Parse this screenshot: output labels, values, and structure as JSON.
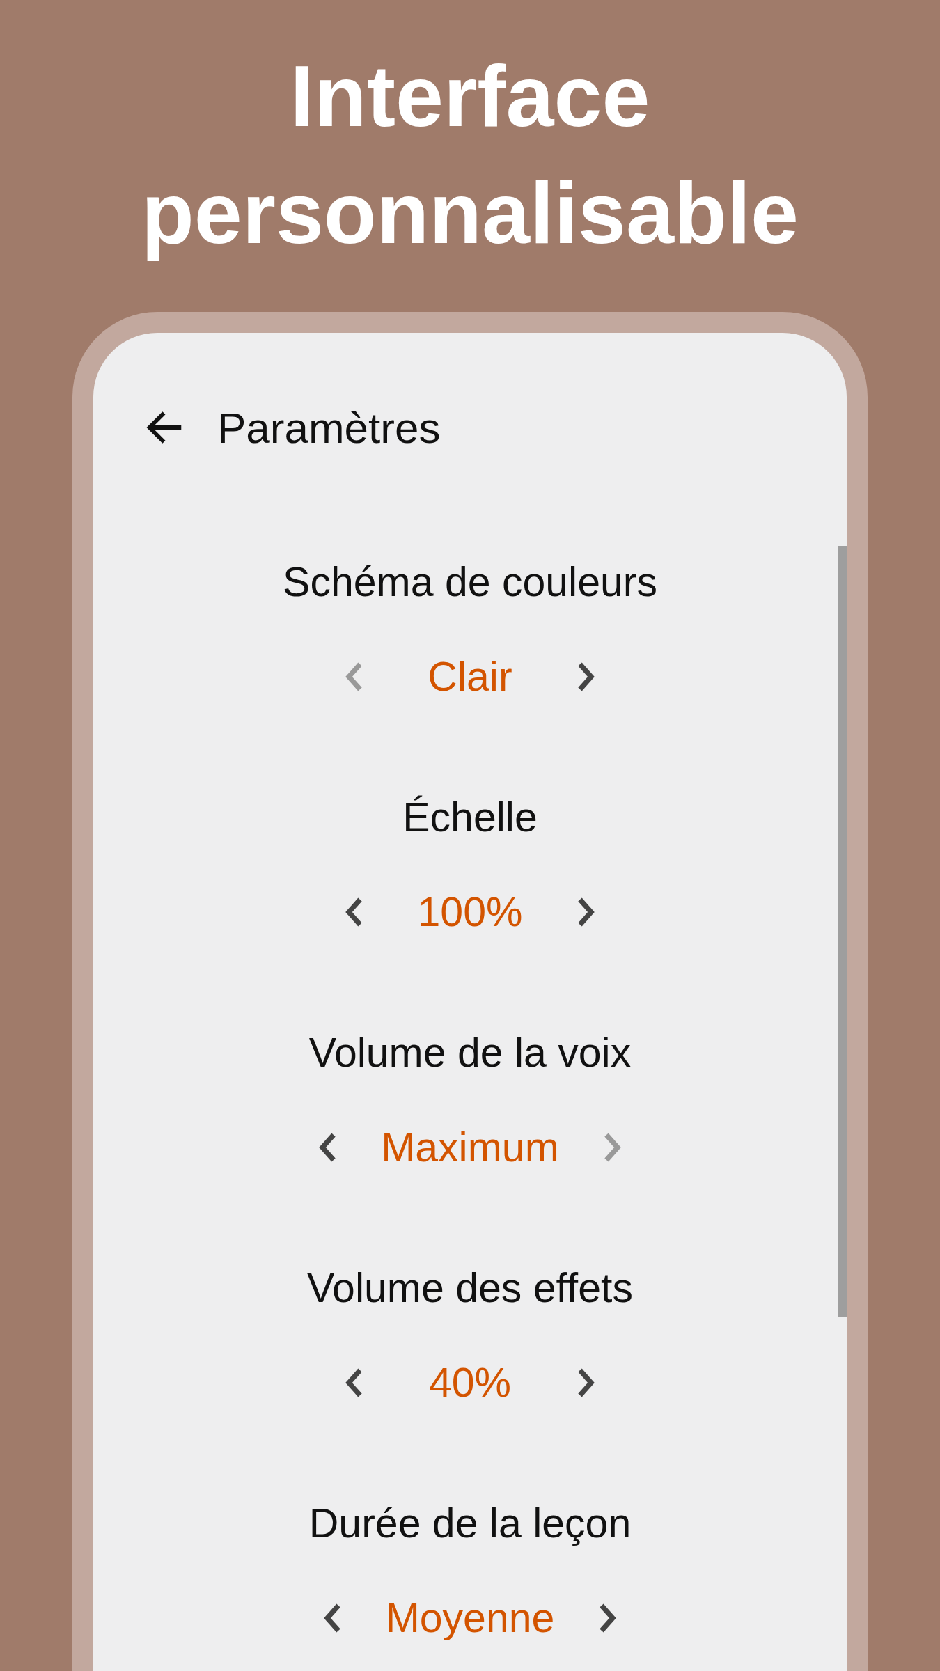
{
  "headline": [
    "Interface",
    "personnalisable"
  ],
  "app_bar": {
    "title": "Paramètres"
  },
  "settings": [
    {
      "label": "Schéma de couleurs",
      "value": "Clair",
      "prev_disabled": true,
      "next_disabled": false
    },
    {
      "label": "Échelle",
      "value": "100%",
      "prev_disabled": false,
      "next_disabled": false
    },
    {
      "label": "Volume de la voix",
      "value": "Maximum",
      "prev_disabled": false,
      "next_disabled": true
    },
    {
      "label": "Volume des effets",
      "value": "40%",
      "prev_disabled": false,
      "next_disabled": false
    },
    {
      "label": "Durée de la leçon",
      "value": "Moyenne",
      "prev_disabled": false,
      "next_disabled": false
    }
  ]
}
